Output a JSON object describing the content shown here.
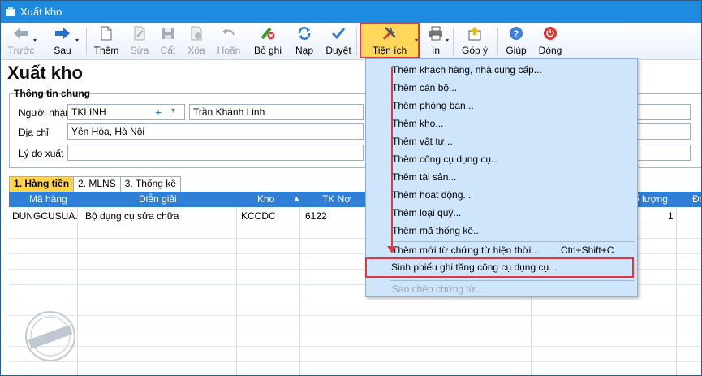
{
  "window": {
    "title": "Xuất kho"
  },
  "toolbar": {
    "back": "Trước",
    "next": "Sau",
    "add": "Thêm",
    "edit": "Sửa",
    "copy": "Cất",
    "delete": "Xóa",
    "undo": "Hoãn",
    "unpost": "Bỏ ghi",
    "reload": "Nạp",
    "approve": "Duyệt",
    "utilities": "Tiện ích",
    "print": "In",
    "feedback": "Góp ý",
    "help": "Giúp",
    "close": "Đóng"
  },
  "page": {
    "title": "Xuất kho"
  },
  "general": {
    "title": "Thông tin chung",
    "receiver_label": "Người nhận",
    "receiver_code": "TKLINH",
    "receiver_name": "Trần Khánh Linh",
    "address_label": "Địa chỉ",
    "address": "Yên Hòa, Hà Nội",
    "reason_label": "Lý do xuất",
    "reason": ""
  },
  "tabs": [
    {
      "num": "1",
      "label": ". Hàng tiền"
    },
    {
      "num": "2",
      "label": ". MLNS"
    },
    {
      "num": "3",
      "label": ". Thống kê"
    }
  ],
  "grid": {
    "headers": {
      "code": "Mã hàng",
      "desc": "Diễn giải",
      "store": "Kho",
      "debit": "TK Nợ",
      "qty": "Số lượng",
      "unit": "Đơ"
    },
    "rows": [
      {
        "code": "DUNGCUSUA...",
        "desc": "Bộ dụng cụ sửa chữa",
        "store": "KCCDC",
        "debit": "6122",
        "qty": "1"
      }
    ]
  },
  "menu": {
    "items": [
      "Thêm khách hàng, nhà cung cấp...",
      "Thêm cán bộ...",
      "Thêm phòng ban...",
      "Thêm kho...",
      "Thêm vật tư...",
      "Thêm công cụ dụng cụ...",
      "Thêm tài sản...",
      "Thêm hoạt động...",
      "Thêm loại quỹ...",
      "Thêm mã thống kê..."
    ],
    "from_voucher": "Thêm mới từ chứng từ hiện thời...",
    "from_voucher_shortcut": "Ctrl+Shift+C",
    "generate": "Sinh phiếu ghi tăng công cụ dụng cụ...",
    "copy_voucher": "Sao chép chứng từ..."
  },
  "watermark": "DỮ LIỆU MẪU",
  "colors": {
    "titlebar": "#1e8be0",
    "grid_header": "#2f7fd6",
    "highlight": "#e0383e",
    "active_tab": "#ffd34a",
    "menu_bg": "#cfe5fb"
  }
}
